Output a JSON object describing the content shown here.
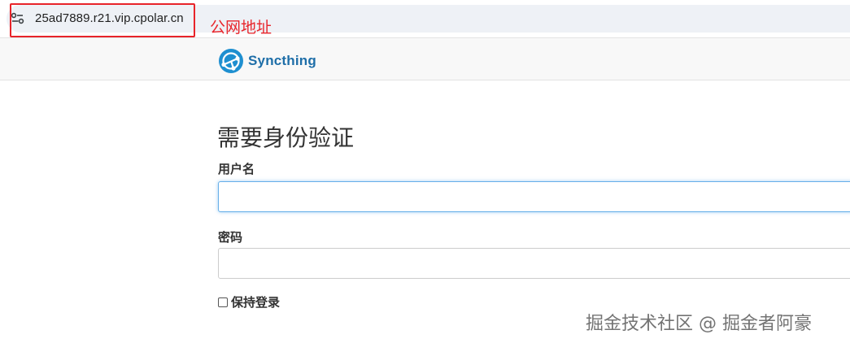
{
  "browser": {
    "url": "25ad7889.r21.vip.cpolar.cn",
    "annotation": "公网地址"
  },
  "navbar": {
    "brand_name": "Syncthing"
  },
  "login": {
    "heading": "需要身份验证",
    "username_label": "用户名",
    "username_value": "",
    "password_label": "密码",
    "password_value": "",
    "remember_label": "保持登录",
    "remember_checked": false
  },
  "watermark": "掘金技术社区 @ 掘金者阿豪",
  "colors": {
    "brand": "#1e6ea8",
    "annotation_red": "#e8242a",
    "focus_blue": "#66afe9"
  }
}
